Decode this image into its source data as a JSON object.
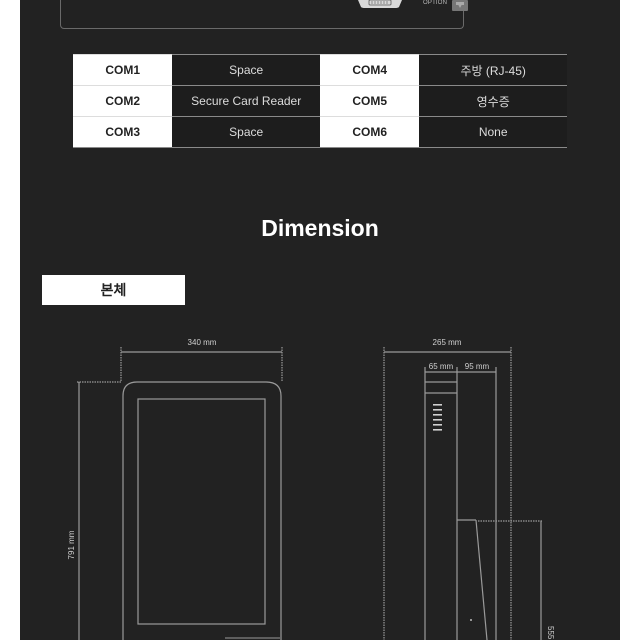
{
  "top_device": {
    "option_label": "OPTION",
    "icons": [
      "db9-serial-port-icon",
      "rj45-port-icon"
    ]
  },
  "com_ports": [
    {
      "left_label": "COM1",
      "left_value": "Space",
      "right_label": "COM4",
      "right_value": "주방 (RJ-45)"
    },
    {
      "left_label": "COM2",
      "left_value": "Secure Card Reader",
      "right_label": "COM5",
      "right_value": "영수증"
    },
    {
      "left_label": "COM3",
      "left_value": "Space",
      "right_label": "COM6",
      "right_value": "None"
    }
  ],
  "dimension": {
    "title": "Dimension",
    "section_tab": "본체",
    "front_view": {
      "width_label": "340 mm",
      "height_label": "791 mm"
    },
    "side_view": {
      "depth_label": "265 mm",
      "segment1_label": "65 mm",
      "segment2_label": "95 mm",
      "lower_height_label": "555"
    }
  }
}
